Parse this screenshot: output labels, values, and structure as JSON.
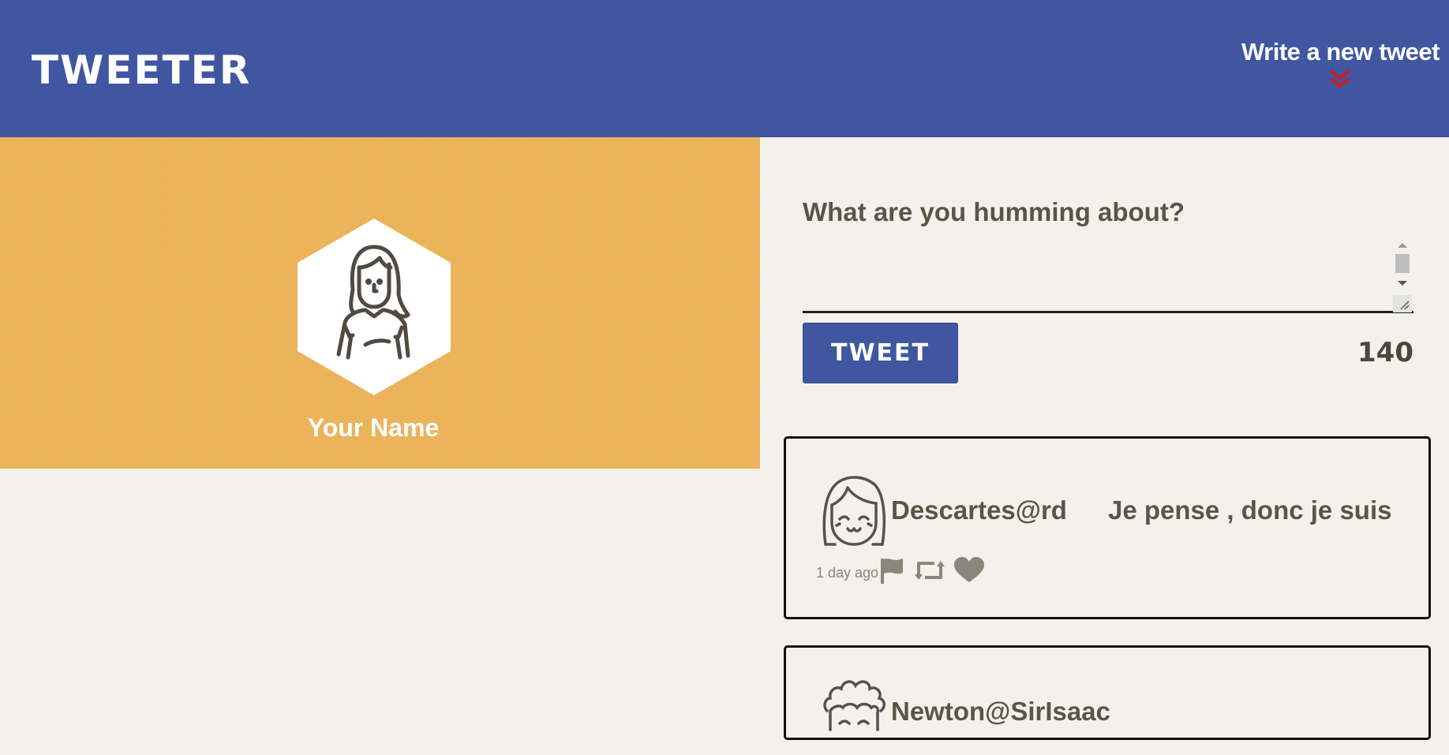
{
  "nav": {
    "brand": "TWEETER",
    "compose_link": "Write a new tweet",
    "compose_icon": "double-chevron-down-icon",
    "compose_icon_color": "#cc1f1f"
  },
  "colors": {
    "nav_bg": "#4056a1",
    "profile_bg": "#ebb35a",
    "page_bg": "#f4f1ec",
    "text": "#5c5446"
  },
  "profile": {
    "name": "Your Name",
    "avatar_icon": "woman-avatar-icon"
  },
  "composer": {
    "prompt": "What are you humming about?",
    "value": "",
    "button_label": "TWEET",
    "counter": "140"
  },
  "tweets": [
    {
      "handle": "Descartes@rd",
      "content": "Je pense , donc je suis",
      "time": "1 day ago",
      "avatar_icon": "smiling-girl-avatar-icon",
      "actions": [
        "flag-icon",
        "retweet-icon",
        "heart-icon"
      ]
    },
    {
      "handle": "Newton@SirIsaac",
      "avatar_icon": "curly-hair-avatar-icon"
    }
  ]
}
